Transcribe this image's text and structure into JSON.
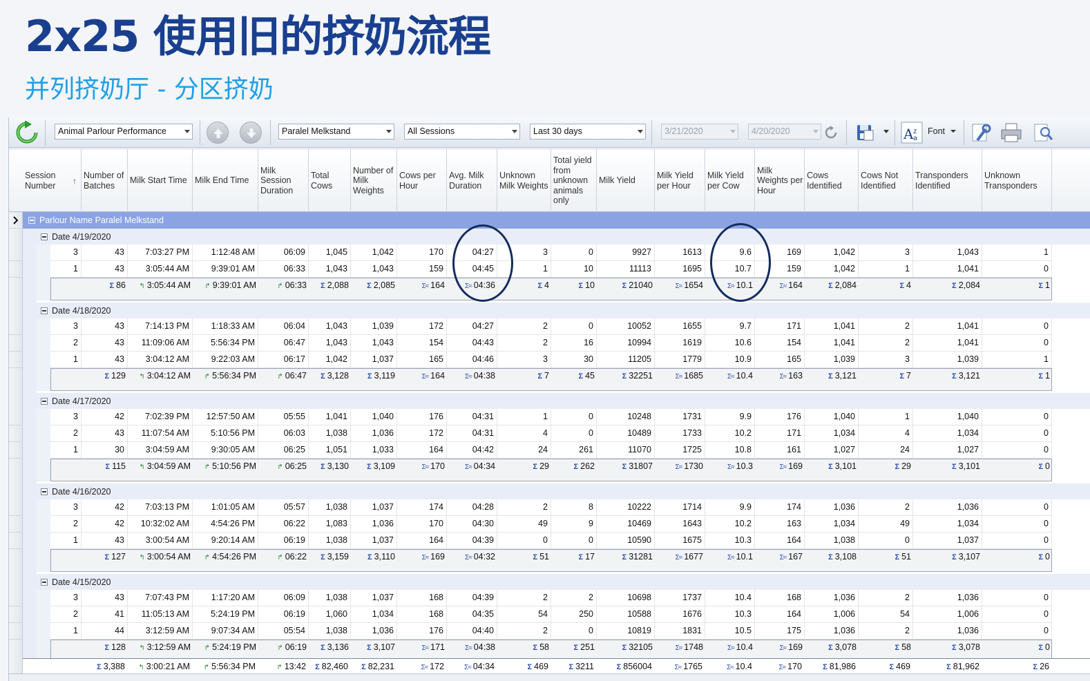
{
  "slide": {
    "title": "2x25 使用旧的挤奶流程",
    "subtitle": "并列挤奶厅 - 分区挤奶"
  },
  "toolbar": {
    "report": "Animal Parlour Performance",
    "parlour": "Paralel Melkstand",
    "sessions": "All Sessions",
    "period": "Last 30 days",
    "date_from": "3/21/2020",
    "date_to": "4/20/2020",
    "font_label": "Font"
  },
  "columns": [
    "Session Number",
    "Number of Batches",
    "Milk Start Time",
    "Milk End Time",
    "Milk Session Duration",
    "Total Cows",
    "Number of Milk Weights",
    "Cows per Hour",
    "Avg. Milk Duration",
    "Unknown Milk Weights",
    "Total yield from unknown animals only",
    "Milk Yield",
    "Milk Yield per Hour",
    "Milk Yield per Cow",
    "Milk Weights per Hour",
    "Cows Identified",
    "Cows Not Identified",
    "Transponders Identified",
    "Unknown Transponders"
  ],
  "parlour_group": "Parlour Name  Paralel Melkstand",
  "groups": [
    {
      "date": "Date  4/19/2020",
      "rows": [
        [
          "3",
          "43",
          "7:03:27 PM",
          "1:12:48 AM",
          "06:09",
          "1,045",
          "1,042",
          "170",
          "04:27",
          "3",
          "0",
          "9927",
          "1613",
          "9.6",
          "169",
          "1,042",
          "3",
          "1,043",
          "1"
        ],
        [
          "1",
          "43",
          "3:05:44 AM",
          "9:39:01 AM",
          "06:33",
          "1,043",
          "1,043",
          "159",
          "04:45",
          "1",
          "10",
          "11113",
          "1695",
          "10.7",
          "159",
          "1,042",
          "1",
          "1,041",
          "0"
        ]
      ],
      "summary": [
        "",
        "86",
        "3:05:44 AM",
        "9:39:01 AM",
        "06:33",
        "2,088",
        "2,085",
        "164",
        "04:36",
        "4",
        "10",
        "21040",
        "1654",
        "10.1",
        "164",
        "2,084",
        "4",
        "2,084",
        "1"
      ]
    },
    {
      "date": "Date  4/18/2020",
      "rows": [
        [
          "3",
          "43",
          "7:14:13 PM",
          "1:18:33 AM",
          "06:04",
          "1,043",
          "1,039",
          "172",
          "04:27",
          "2",
          "0",
          "10052",
          "1655",
          "9.7",
          "171",
          "1,041",
          "2",
          "1,041",
          "0"
        ],
        [
          "2",
          "43",
          "11:09:06 AM",
          "5:56:34 PM",
          "06:47",
          "1,043",
          "1,043",
          "154",
          "04:43",
          "2",
          "16",
          "10994",
          "1619",
          "10.6",
          "154",
          "1,041",
          "2",
          "1,041",
          "0"
        ],
        [
          "1",
          "43",
          "3:04:12 AM",
          "9:22:03 AM",
          "06:17",
          "1,042",
          "1,037",
          "165",
          "04:46",
          "3",
          "30",
          "11205",
          "1779",
          "10.9",
          "165",
          "1,039",
          "3",
          "1,039",
          "1"
        ]
      ],
      "summary": [
        "",
        "129",
        "3:04:12 AM",
        "5:56:34 PM",
        "06:47",
        "3,128",
        "3,119",
        "164",
        "04:38",
        "7",
        "45",
        "32251",
        "1685",
        "10.4",
        "163",
        "3,121",
        "7",
        "3,121",
        "1"
      ]
    },
    {
      "date": "Date  4/17/2020",
      "rows": [
        [
          "3",
          "42",
          "7:02:39 PM",
          "12:57:50 AM",
          "05:55",
          "1,041",
          "1,040",
          "176",
          "04:31",
          "1",
          "0",
          "10248",
          "1731",
          "9.9",
          "176",
          "1,040",
          "1",
          "1,040",
          "0"
        ],
        [
          "2",
          "43",
          "11:07:54 AM",
          "5:10:56 PM",
          "06:03",
          "1,038",
          "1,036",
          "172",
          "04:31",
          "4",
          "0",
          "10489",
          "1733",
          "10.2",
          "171",
          "1,034",
          "4",
          "1,034",
          "0"
        ],
        [
          "1",
          "30",
          "3:04:59 AM",
          "9:30:05 AM",
          "06:25",
          "1,051",
          "1,033",
          "164",
          "04:42",
          "24",
          "261",
          "11070",
          "1725",
          "10.8",
          "161",
          "1,027",
          "24",
          "1,027",
          "0"
        ]
      ],
      "summary": [
        "",
        "115",
        "3:04:59 AM",
        "5:10:56 PM",
        "06:25",
        "3,130",
        "3,109",
        "170",
        "04:34",
        "29",
        "262",
        "31807",
        "1730",
        "10.3",
        "169",
        "3,101",
        "29",
        "3,101",
        "0"
      ]
    },
    {
      "date": "Date  4/16/2020",
      "rows": [
        [
          "3",
          "42",
          "7:03:13 PM",
          "1:01:05 AM",
          "05:57",
          "1,038",
          "1,037",
          "174",
          "04:28",
          "2",
          "8",
          "10222",
          "1714",
          "9.9",
          "174",
          "1,036",
          "2",
          "1,036",
          "0"
        ],
        [
          "2",
          "42",
          "10:32:02 AM",
          "4:54:26 PM",
          "06:22",
          "1,083",
          "1,036",
          "170",
          "04:30",
          "49",
          "9",
          "10469",
          "1643",
          "10.2",
          "163",
          "1,034",
          "49",
          "1,034",
          "0"
        ],
        [
          "1",
          "43",
          "3:00:54 AM",
          "9:20:14 AM",
          "06:19",
          "1,038",
          "1,037",
          "164",
          "04:39",
          "0",
          "0",
          "10590",
          "1675",
          "10.3",
          "164",
          "1,038",
          "0",
          "1,037",
          "0"
        ]
      ],
      "summary": [
        "",
        "127",
        "3:00:54 AM",
        "4:54:26 PM",
        "06:22",
        "3,159",
        "3,110",
        "169",
        "04:32",
        "51",
        "17",
        "31281",
        "1677",
        "10.1",
        "167",
        "3,108",
        "51",
        "3,107",
        "0"
      ]
    },
    {
      "date": "Date  4/15/2020",
      "rows": [
        [
          "3",
          "43",
          "7:07:43 PM",
          "1:17:20 AM",
          "06:09",
          "1,038",
          "1,037",
          "168",
          "04:39",
          "2",
          "2",
          "10698",
          "1737",
          "10.4",
          "168",
          "1,036",
          "2",
          "1,036",
          "0"
        ],
        [
          "2",
          "41",
          "11:05:13 AM",
          "5:24:19 PM",
          "06:19",
          "1,060",
          "1,034",
          "168",
          "04:35",
          "54",
          "250",
          "10588",
          "1676",
          "10.3",
          "164",
          "1,006",
          "54",
          "1,006",
          "0"
        ],
        [
          "1",
          "44",
          "3:12:59 AM",
          "9:07:34 AM",
          "05:54",
          "1,038",
          "1,036",
          "176",
          "04:40",
          "2",
          "0",
          "10819",
          "1831",
          "10.5",
          "175",
          "1,036",
          "2",
          "1,036",
          "0"
        ]
      ],
      "summary": [
        "",
        "128",
        "3:12:59 AM",
        "5:24:19 PM",
        "06:19",
        "3,136",
        "3,107",
        "171",
        "04:38",
        "58",
        "251",
        "32105",
        "1748",
        "10.4",
        "169",
        "3,078",
        "58",
        "3,078",
        "0"
      ]
    }
  ],
  "grand_total": [
    "",
    "3,388",
    "3:00:21 AM",
    "5:56:34 PM",
    "13:42",
    "82,460",
    "82,231",
    "172",
    "04:34",
    "469",
    "3211",
    "856004",
    "1765",
    "10.4",
    "170",
    "81,986",
    "469",
    "81,962",
    "26"
  ]
}
